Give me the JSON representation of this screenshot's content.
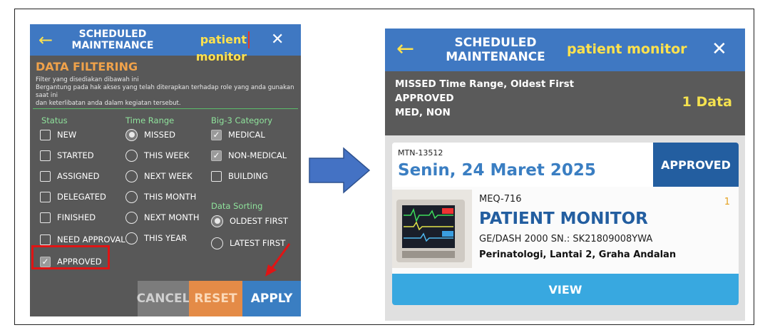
{
  "left_screen": {
    "header": {
      "back_icon": "arrow-left-icon",
      "title_line1": "SCHEDULED",
      "title_line2": "MAINTENANCE",
      "search_value": "patient monitor",
      "close_icon": "close-icon"
    },
    "filtering": {
      "title": "DATA FILTERING",
      "desc_line1": "Filter yang disediakan dibawah ini",
      "desc_line2": "Bergantung pada hak akses yang telah diterapkan terhadap role yang anda gunakan saat ini",
      "desc_line3": "dan keterlibatan anda dalam kegiatan tersebut."
    },
    "status": {
      "header": "Status",
      "options": [
        {
          "label": "NEW",
          "checked": false
        },
        {
          "label": "STARTED",
          "checked": false
        },
        {
          "label": "ASSIGNED",
          "checked": false
        },
        {
          "label": "DELEGATED",
          "checked": false
        },
        {
          "label": "FINISHED",
          "checked": false
        },
        {
          "label": "NEED APPROVAL",
          "checked": false
        },
        {
          "label": "APPROVED",
          "checked": true
        }
      ]
    },
    "time_range": {
      "header": "Time Range",
      "options": [
        {
          "label": "MISSED",
          "selected": true
        },
        {
          "label": "THIS WEEK",
          "selected": false
        },
        {
          "label": "NEXT WEEK",
          "selected": false
        },
        {
          "label": "THIS MONTH",
          "selected": false
        },
        {
          "label": "NEXT MONTH",
          "selected": false
        },
        {
          "label": "THIS YEAR",
          "selected": false
        }
      ]
    },
    "category": {
      "header": "Big-3 Category",
      "options": [
        {
          "label": "MEDICAL",
          "checked": true
        },
        {
          "label": "NON-MEDICAL",
          "checked": true
        },
        {
          "label": "BUILDING",
          "checked": false
        }
      ]
    },
    "sorting": {
      "header": "Data Sorting",
      "options": [
        {
          "label": "OLDEST FIRST",
          "selected": true
        },
        {
          "label": "LATEST FIRST",
          "selected": false
        }
      ]
    },
    "buttons": {
      "cancel": "CANCEL",
      "reset": "RESET",
      "apply": "APPLY"
    },
    "annotation_color": "#e01414"
  },
  "arrow_color": "#4472c4",
  "right_screen": {
    "header": {
      "back_icon": "arrow-left-icon",
      "title_line1": "SCHEDULED",
      "title_line2": "MAINTENANCE",
      "search_value": "patient monitor",
      "close_icon": "close-icon"
    },
    "summary": {
      "line1": "MISSED Time Range, Oldest First",
      "line2": "APPROVED",
      "line3": "MED, NON",
      "count": "1 Data"
    },
    "card": {
      "code": "MTN-13512",
      "date": "Senin, 24 Maret 2025",
      "status": "APPROVED",
      "equipment_code": "MEQ-716",
      "equipment_name": "PATIENT MONITOR",
      "model": "GE/DASH 2000  SN.: SK21809008YWA",
      "location": "Perinatologi, Lantai 2, Graha Andalan",
      "index": "1",
      "view_label": "VIEW"
    },
    "colors": {
      "header": "#3f78c2",
      "accent_yellow": "#ffe24d",
      "status_blue": "#235ea0",
      "view_blue": "#38a8e0"
    }
  }
}
